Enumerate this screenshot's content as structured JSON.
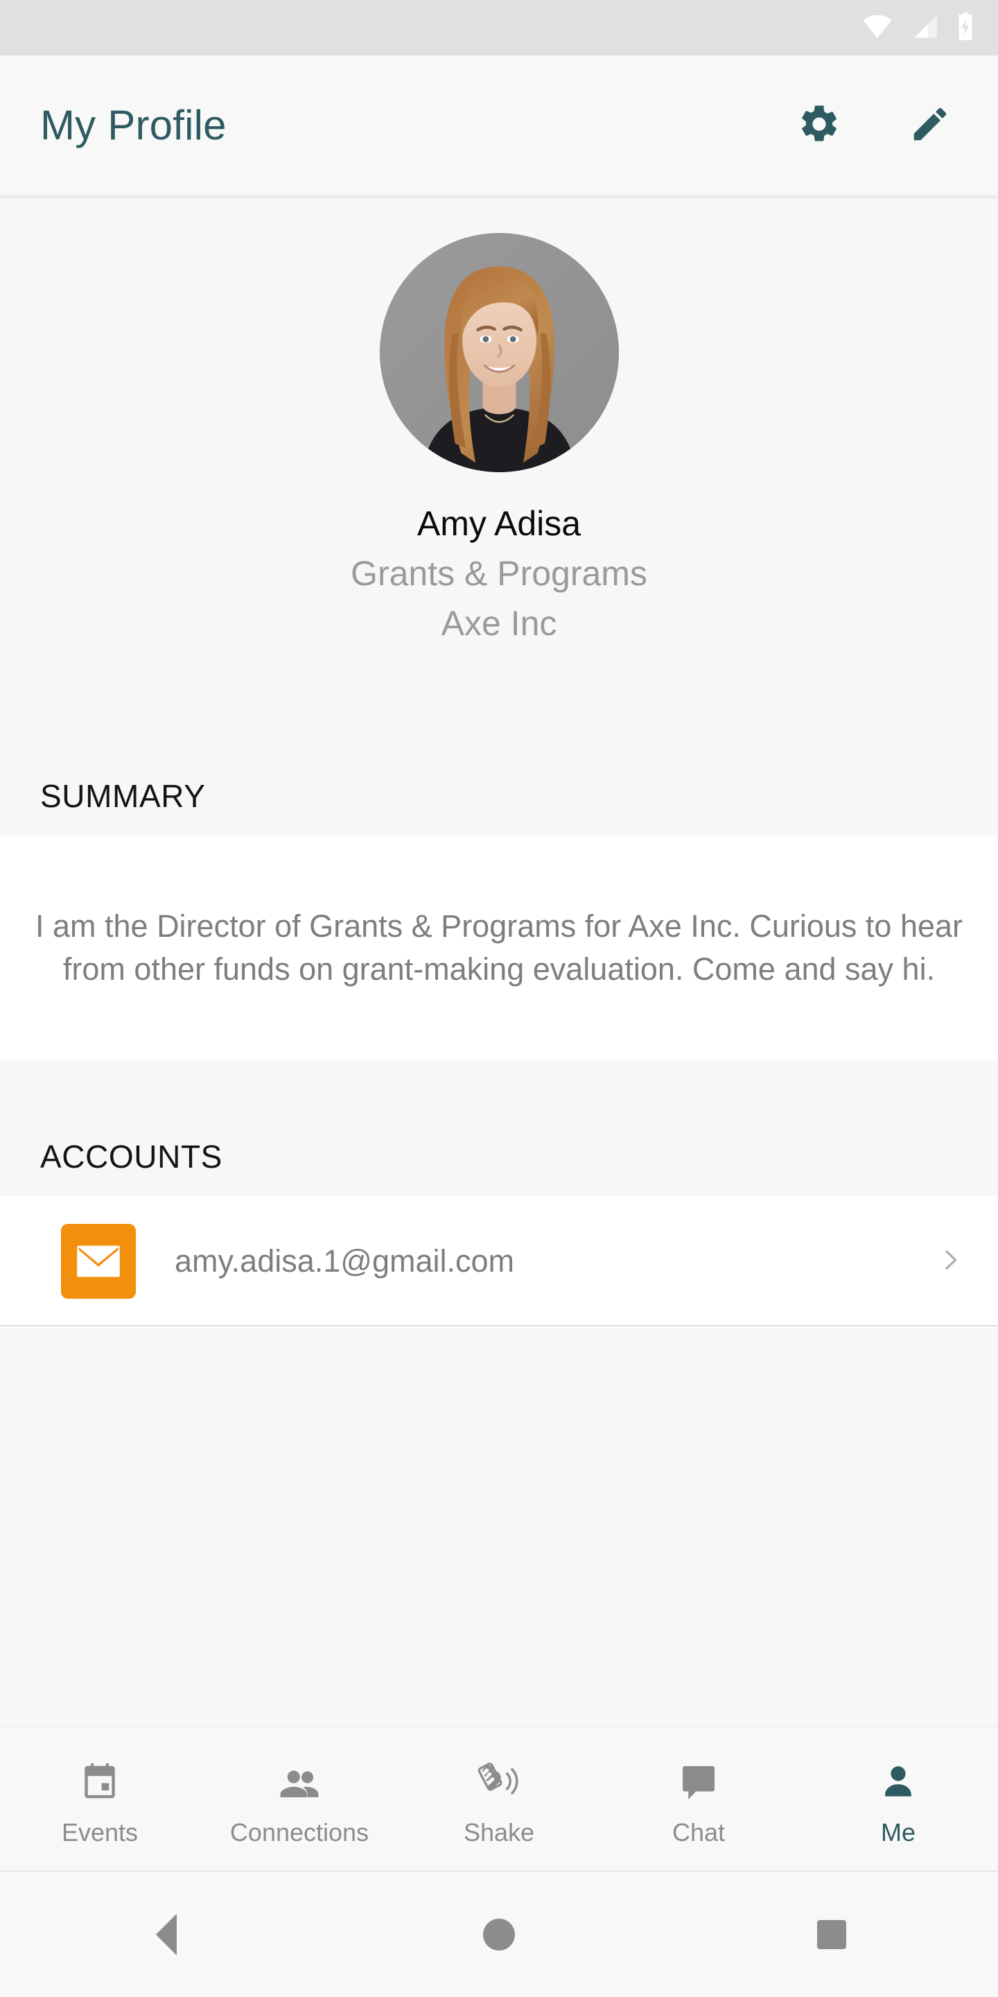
{
  "status_bar": {
    "icons": [
      "wifi-icon",
      "cellular-signal-icon",
      "battery-charging-icon"
    ]
  },
  "app_bar": {
    "title": "My Profile",
    "accent_color": "#2E5B62",
    "actions": [
      {
        "name": "settings-button",
        "icon": "gear-icon"
      },
      {
        "name": "edit-profile-button",
        "icon": "pencil-icon"
      }
    ]
  },
  "profile": {
    "avatar_alt": "profile-photo",
    "name": "Amy Adisa",
    "title": "Grants & Programs",
    "company": "Axe Inc"
  },
  "summary": {
    "header": "SUMMARY",
    "body": "I am the Director of Grants & Programs for Axe Inc. Curious to hear from other funds on grant-making evaluation. Come and say hi."
  },
  "accounts": {
    "header": "ACCOUNTS",
    "items": [
      {
        "icon": "email-icon",
        "icon_color": "#F2900D",
        "email": "amy.adisa.1@gmail.com",
        "chevron": "chevron-right-icon"
      }
    ]
  },
  "bottom_nav": {
    "active_color": "#2E5B62",
    "inactive_color": "#8C8C8C",
    "items": [
      {
        "label": "Events",
        "icon": "calendar-icon",
        "active": false
      },
      {
        "label": "Connections",
        "icon": "people-icon",
        "active": false
      },
      {
        "label": "Shake",
        "icon": "shake-phone-icon",
        "active": false
      },
      {
        "label": "Chat",
        "icon": "chat-bubble-icon",
        "active": false
      },
      {
        "label": "Me",
        "icon": "person-icon",
        "active": true
      }
    ]
  },
  "system_nav": {
    "back": "back-triangle-icon",
    "home": "home-circle-icon",
    "recents": "recents-square-icon"
  }
}
